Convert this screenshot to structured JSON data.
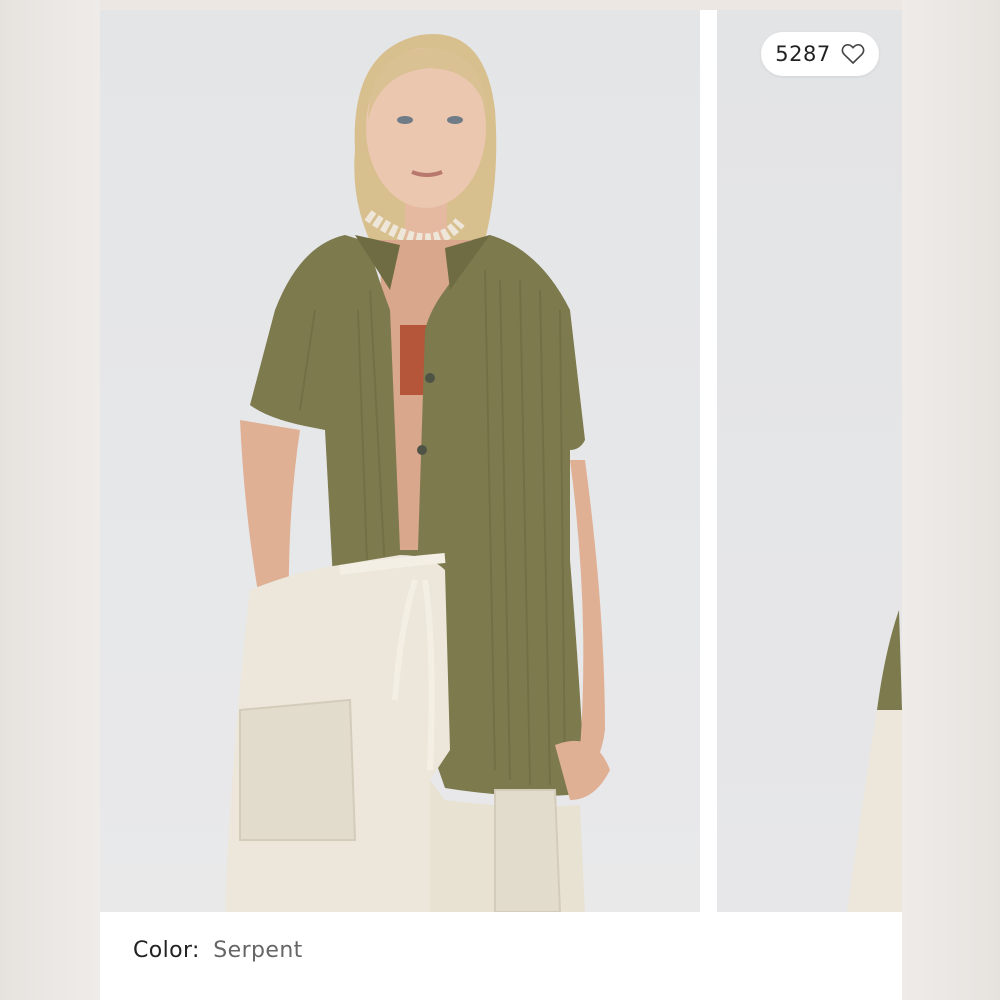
{
  "product": {
    "like_count": "5287",
    "like_icon": "heart-outline-icon",
    "color_label": "Color:",
    "color_value": "Serpent"
  },
  "colors": {
    "shirt": "#7d7a4e",
    "pants": "#ece7da",
    "backdrop": "#e5e6e8"
  }
}
